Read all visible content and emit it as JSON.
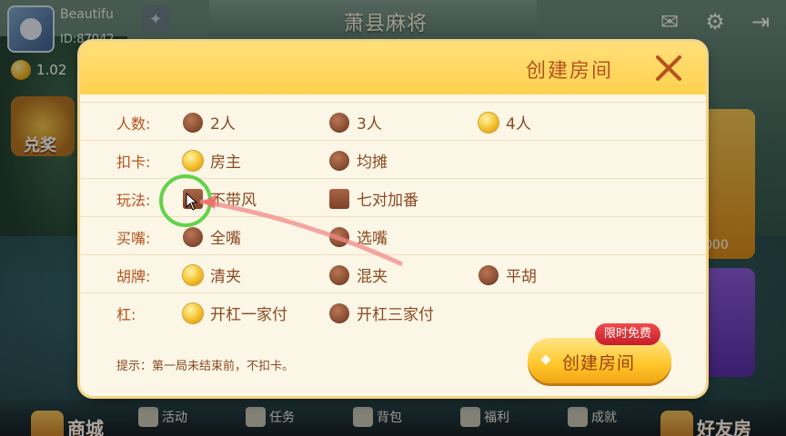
{
  "header": {
    "username": "Beautifu",
    "user_id": "ID:87042",
    "coins": "1.02",
    "game_title": "萧县麻将",
    "icons": [
      "mail-icon",
      "gear-icon",
      "exit-icon"
    ]
  },
  "side": {
    "redeem_label": "兑奖",
    "card1_value": "000"
  },
  "nav": {
    "shop": "商城",
    "events": "活动",
    "tasks": "任务",
    "bag": "背包",
    "welfare": "福利",
    "achievements": "成就",
    "friend_room": "好友房"
  },
  "modal": {
    "title": "创建房间",
    "rows": [
      {
        "label": "人数:",
        "options": [
          {
            "text": "2人",
            "selected": false
          },
          {
            "text": "3人",
            "selected": false
          },
          {
            "text": "4人",
            "selected": true
          }
        ]
      },
      {
        "label": "扣卡:",
        "options": [
          {
            "text": "房主",
            "selected": true
          },
          {
            "text": "均摊",
            "selected": false
          }
        ]
      },
      {
        "label": "玩法:",
        "options": [
          {
            "text": "不带风",
            "checked": false
          },
          {
            "text": "七对加番",
            "checked": false
          }
        ]
      },
      {
        "label": "买嘴:",
        "options": [
          {
            "text": "全嘴",
            "selected": false
          },
          {
            "text": "选嘴",
            "selected": false
          }
        ]
      },
      {
        "label": "胡牌:",
        "options": [
          {
            "text": "清夹",
            "selected": true
          },
          {
            "text": "混夹",
            "selected": false
          },
          {
            "text": "平胡",
            "selected": false
          }
        ]
      },
      {
        "label": "杠:",
        "options": [
          {
            "text": "开杠一家付",
            "selected": true
          },
          {
            "text": "开杠三家付",
            "selected": false
          }
        ]
      }
    ],
    "tip": "提示：第一局未结束前，不扣卡。",
    "create_button": "创建房间",
    "promo_badge": "限时免费"
  },
  "colors": {
    "accent": "#b5521d",
    "header_yellow": "#ffd04d",
    "highlight_green": "#62d34a"
  }
}
